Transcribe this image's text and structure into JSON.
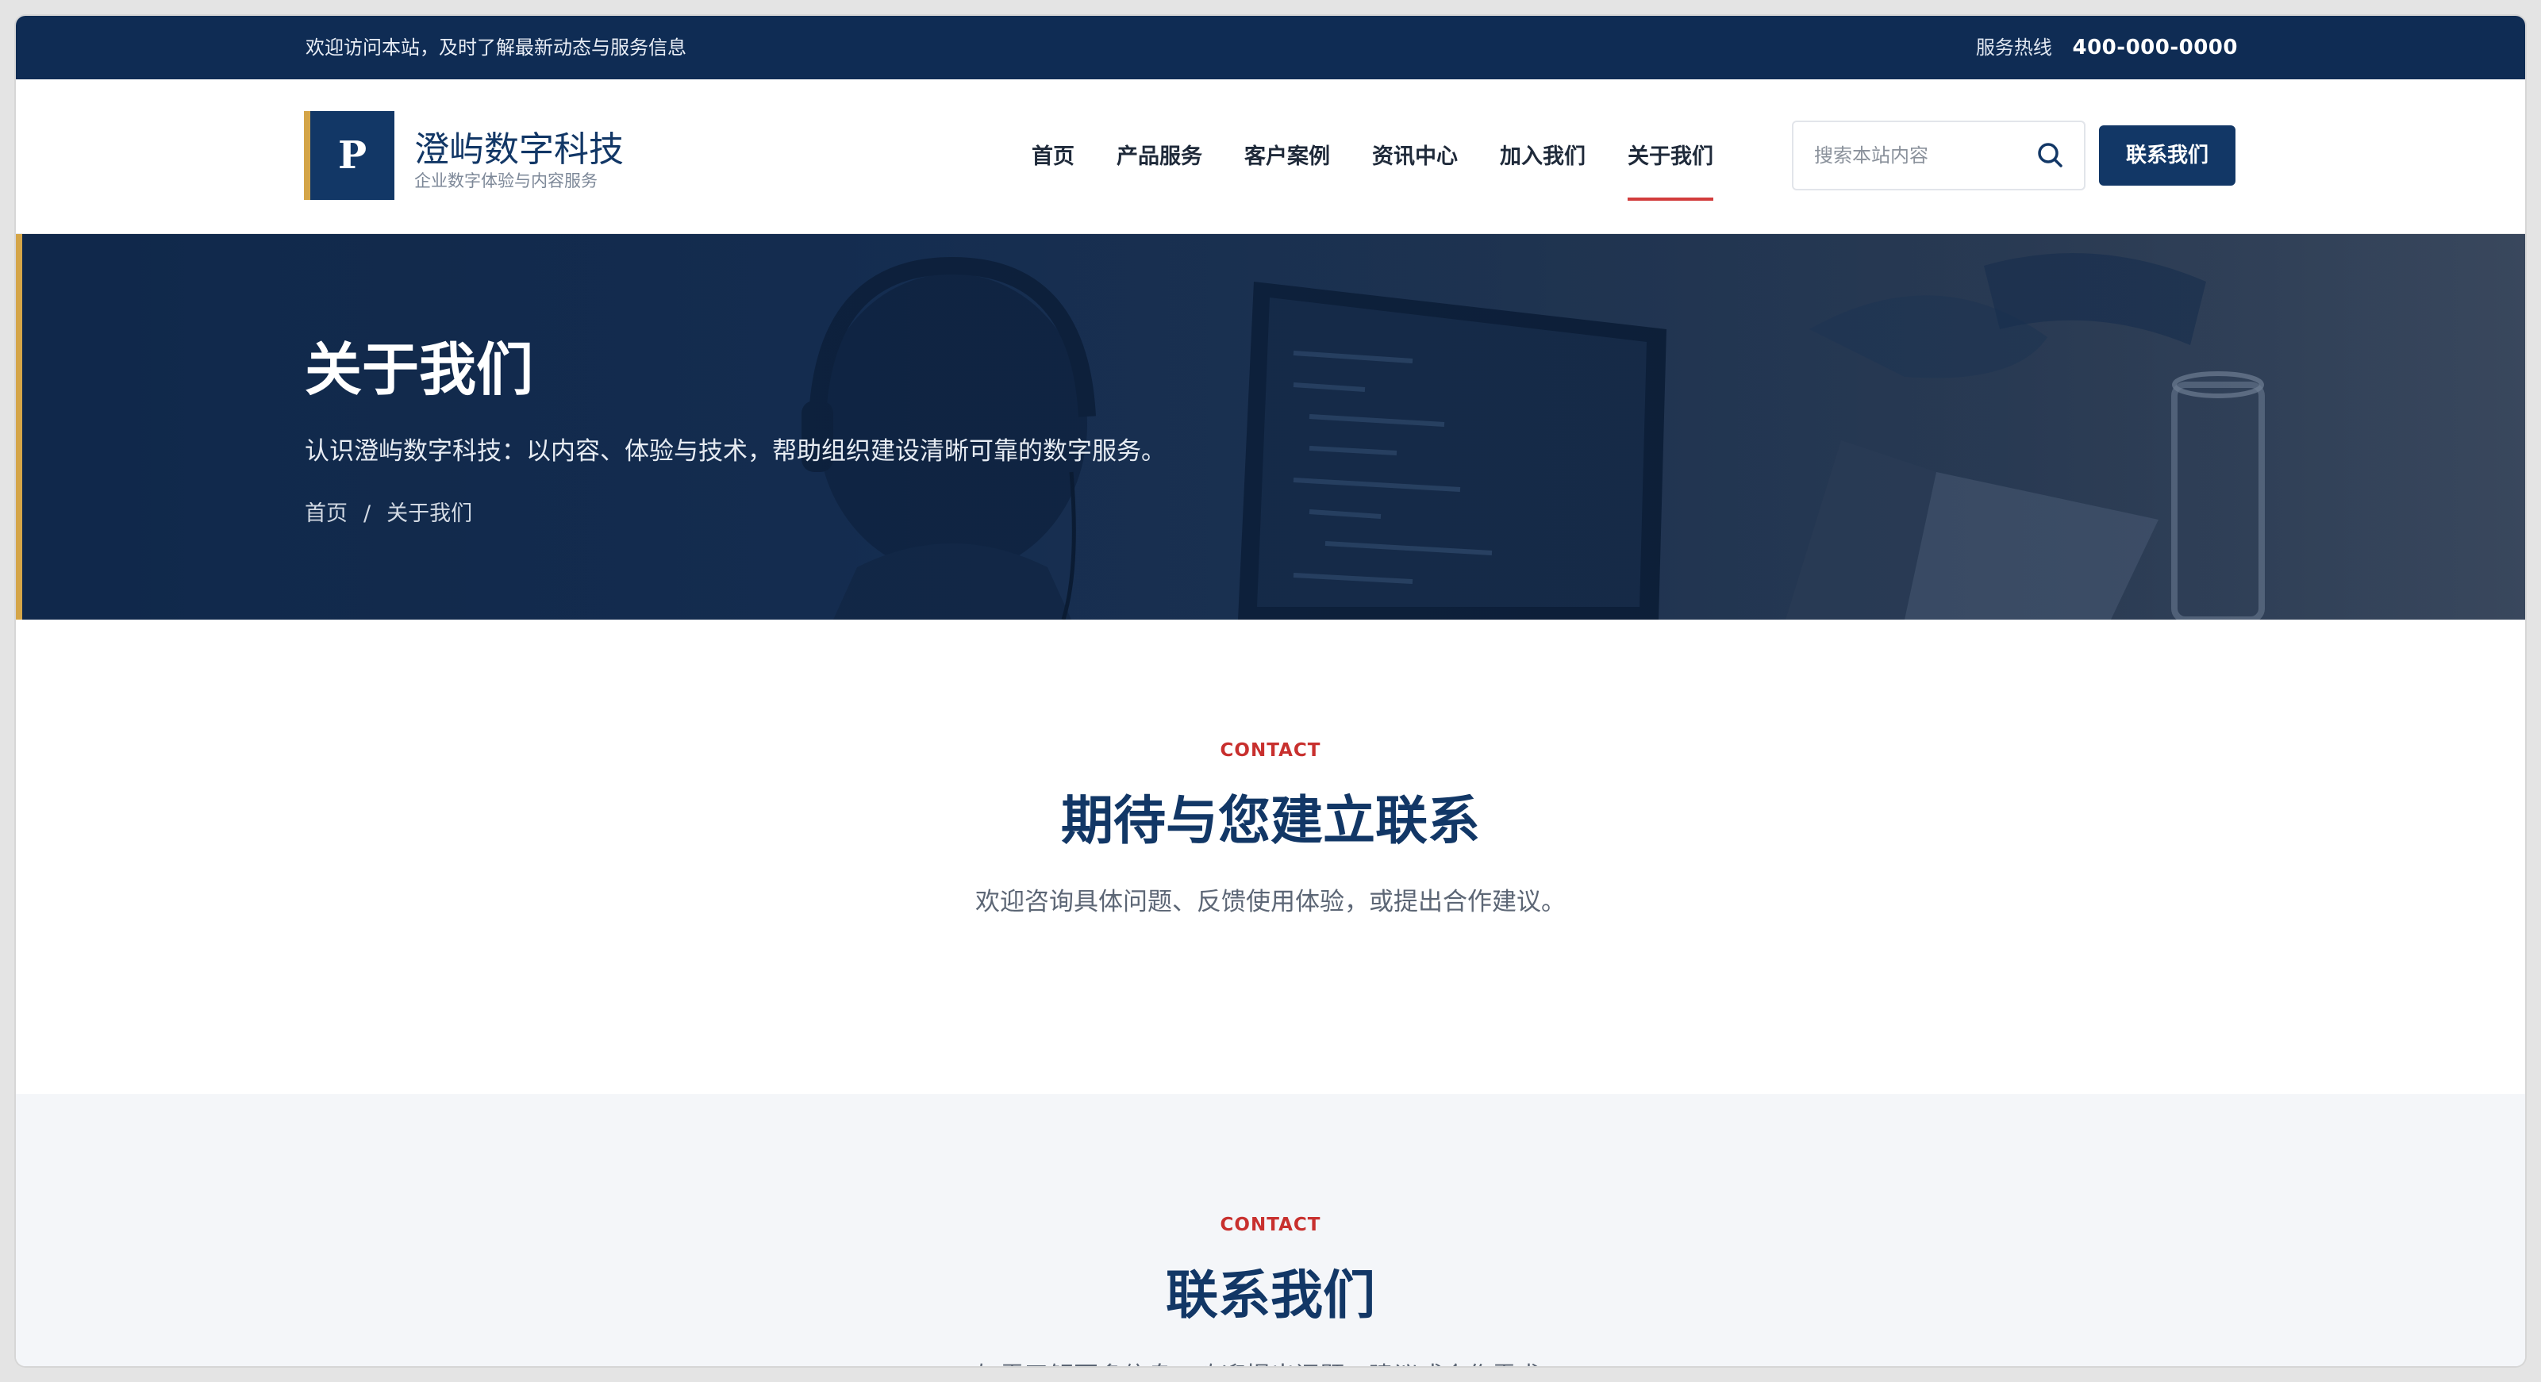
{
  "topbar": {
    "welcome": "欢迎访问本站，及时了解最新动态与服务信息",
    "hotline_label": "服务热线",
    "hotline_number": "400-000-0000"
  },
  "brand": {
    "mark": "P",
    "name": "澄屿数字科技",
    "tagline": "企业数字体验与内容服务",
    "accent_color": "#d4a548",
    "primary_color": "#123766"
  },
  "nav": {
    "items": [
      {
        "label": "首页"
      },
      {
        "label": "产品服务"
      },
      {
        "label": "客户案例"
      },
      {
        "label": "资讯中心"
      },
      {
        "label": "加入我们"
      },
      {
        "label": "关于我们",
        "active": true
      }
    ],
    "active_color": "#d23c3c"
  },
  "search": {
    "placeholder": "搜索本站内容",
    "icon": "search-icon"
  },
  "header_button": {
    "label": "联系我们"
  },
  "hero": {
    "title": "关于我们",
    "description": "认识澄屿数字科技：以内容、体验与技术，帮助组织建设清晰可靠的数字服务。",
    "breadcrumb": {
      "home": "首页",
      "separator": "/",
      "current": "关于我们"
    }
  },
  "contact_intro": {
    "eyebrow": "CONTACT",
    "title": "期待与您建立联系",
    "description": "欢迎咨询具体问题、反馈使用体验，或提出合作建议。"
  },
  "contact_section": {
    "eyebrow": "CONTACT",
    "title": "联系我们",
    "description": "如需了解更多信息，欢迎提出问题、建议或合作需求。"
  }
}
